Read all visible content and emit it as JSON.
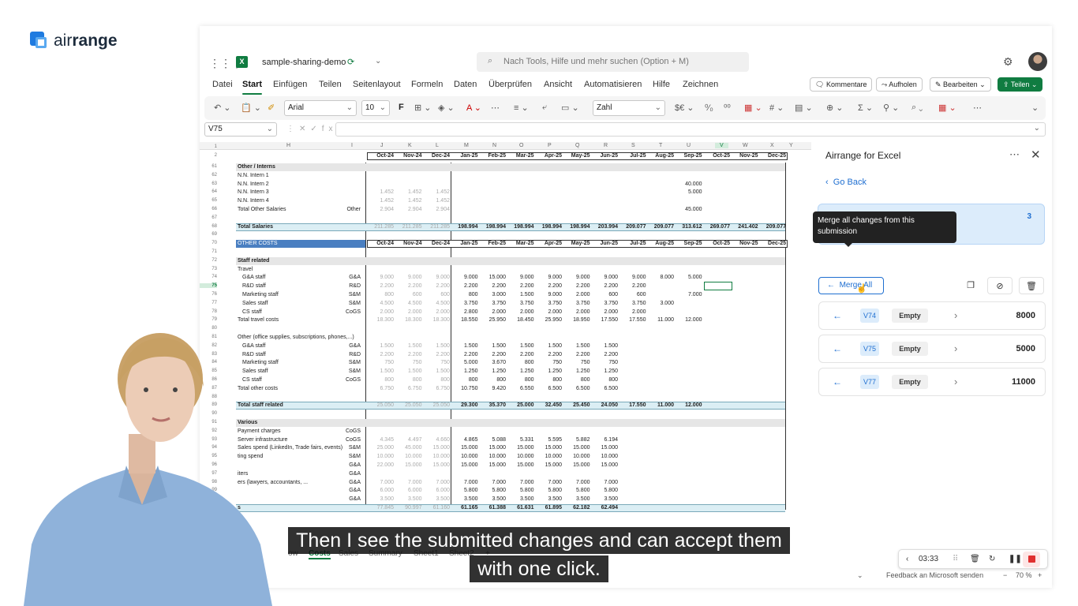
{
  "logo": {
    "prefix": "air",
    "suffix": "range"
  },
  "excel": {
    "file_name": "sample-sharing-demo",
    "search_placeholder": "Nach Tools, Hilfe und mehr suchen (Option + M)",
    "menu": [
      "Datei",
      "Start",
      "Einfügen",
      "Teilen",
      "Seitenlayout",
      "Formeln",
      "Daten",
      "Überprüfen",
      "Ansicht",
      "Automatisieren",
      "Hilfe",
      "Zeichnen"
    ],
    "actions": {
      "comments": "Kommentare",
      "catchup": "Aufholen",
      "editing": "Bearbeiten",
      "share": "Teilen"
    },
    "ribbon": {
      "font": "Arial",
      "size": "10",
      "format": "Zahl",
      "bold": "F"
    },
    "name_box": "V75",
    "col_headers": [
      "H",
      "I",
      "J",
      "K",
      "L",
      "M",
      "N",
      "O",
      "P",
      "Q",
      "R",
      "S",
      "T",
      "U",
      "V",
      "W",
      "X",
      "Y"
    ],
    "months": [
      "Oct-24",
      "Nov-24",
      "Dec-24",
      "Jan-25",
      "Feb-25",
      "Mar-25",
      "Apr-25",
      "May-25",
      "Jun-25",
      "Jul-25",
      "Aug-25",
      "Sep-25",
      "Oct-25",
      "Nov-25",
      "Dec-25"
    ],
    "rows": [
      {
        "n": "61",
        "label": "Other / Interns",
        "tag": "",
        "vals": [],
        "style": "section"
      },
      {
        "n": "62",
        "label": "N.N. Intern 1",
        "tag": "",
        "vals": []
      },
      {
        "n": "63",
        "label": "N.N. Intern 2",
        "tag": "",
        "vals": [
          "",
          "",
          "",
          "",
          "",
          "",
          "",
          "",
          "",
          "",
          "",
          "40.000"
        ]
      },
      {
        "n": "64",
        "label": "N.N. Intern 3",
        "tag": "",
        "vals": [
          "1.452",
          "1.452",
          "1.452",
          "",
          "",
          "",
          "",
          "",
          "",
          "",
          "",
          "5.000"
        ]
      },
      {
        "n": "65",
        "label": "N.N. Intern 4",
        "tag": "",
        "vals": [
          "1.452",
          "1.452",
          "1.452"
        ]
      },
      {
        "n": "66",
        "label": "Total Other Salaries",
        "tag": "Other",
        "vals": [
          "2.904",
          "2.904",
          "2.904",
          "",
          "",
          "",
          "",
          "",
          "",
          "",
          "",
          "45.000"
        ]
      },
      {
        "n": "67",
        "label": "",
        "tag": "",
        "vals": []
      },
      {
        "n": "68",
        "label": "Total Salaries",
        "tag": "",
        "vals": [
          "211.285",
          "211.285",
          "211.285",
          "198.994",
          "198.994",
          "198.994",
          "198.994",
          "198.994",
          "203.994",
          "209.077",
          "209.077",
          "313.612",
          "269.077",
          "241.402",
          "209.077"
        ],
        "style": "total"
      },
      {
        "n": "69",
        "label": "",
        "tag": "",
        "vals": []
      },
      {
        "n": "70",
        "label": "OTHER COSTS",
        "tag": "",
        "vals": [],
        "style": "header"
      },
      {
        "n": "71",
        "label": "",
        "tag": "",
        "vals": []
      },
      {
        "n": "72",
        "label": "Staff related",
        "tag": "",
        "vals": [],
        "style": "section"
      },
      {
        "n": "73",
        "label": "Travel",
        "tag": "",
        "vals": []
      },
      {
        "n": "74",
        "label": "G&A staff",
        "tag": "G&A",
        "vals": [
          "9.000",
          "9.000",
          "9.000",
          "9.000",
          "15.000",
          "9.000",
          "9.000",
          "9.000",
          "9.000",
          "9.000",
          "8.000",
          "5.000"
        ]
      },
      {
        "n": "75",
        "label": "R&D staff",
        "tag": "R&D",
        "vals": [
          "2.200",
          "2.200",
          "2.200",
          "2.200",
          "2.200",
          "2.200",
          "2.200",
          "2.200",
          "2.200",
          "2.200"
        ]
      },
      {
        "n": "76",
        "label": "Marketing staff",
        "tag": "S&M",
        "vals": [
          "800",
          "600",
          "600",
          "800",
          "3.000",
          "1.500",
          "9.000",
          "2.000",
          "600",
          "600",
          "",
          "7.000"
        ]
      },
      {
        "n": "77",
        "label": "Sales staff",
        "tag": "S&M",
        "vals": [
          "4.500",
          "4.500",
          "4.500",
          "3.750",
          "3.750",
          "3.750",
          "3.750",
          "3.750",
          "3.750",
          "3.750",
          "3.000"
        ]
      },
      {
        "n": "78",
        "label": "CS staff",
        "tag": "CoGS",
        "vals": [
          "2.000",
          "2.000",
          "2.000",
          "2.800",
          "2.000",
          "2.000",
          "2.000",
          "2.000",
          "2.000",
          "2.000"
        ]
      },
      {
        "n": "79",
        "label": "Total travel costs",
        "tag": "",
        "vals": [
          "18.300",
          "18.300",
          "18.300",
          "18.550",
          "25.950",
          "18.450",
          "25.950",
          "18.950",
          "17.550",
          "17.550",
          "11.000",
          "12.000"
        ]
      },
      {
        "n": "80",
        "label": "",
        "tag": "",
        "vals": []
      },
      {
        "n": "81",
        "label": "Other (office supplies, subscriptions, phones,...)",
        "tag": "",
        "vals": []
      },
      {
        "n": "82",
        "label": "G&A staff",
        "tag": "G&A",
        "vals": [
          "1.500",
          "1.500",
          "1.500",
          "1.500",
          "1.500",
          "1.500",
          "1.500",
          "1.500",
          "1.500"
        ]
      },
      {
        "n": "83",
        "label": "R&D staff",
        "tag": "R&D",
        "vals": [
          "2.200",
          "2.200",
          "2.200",
          "2.200",
          "2.200",
          "2.200",
          "2.200",
          "2.200",
          "2.200"
        ]
      },
      {
        "n": "84",
        "label": "Marketing staff",
        "tag": "S&M",
        "vals": [
          "750",
          "750",
          "750",
          "5.000",
          "3.670",
          "800",
          "750",
          "750",
          "750"
        ]
      },
      {
        "n": "85",
        "label": "Sales staff",
        "tag": "S&M",
        "vals": [
          "1.500",
          "1.500",
          "1.500",
          "1.250",
          "1.250",
          "1.250",
          "1.250",
          "1.250",
          "1.250"
        ]
      },
      {
        "n": "86",
        "label": "CS staff",
        "tag": "CoGS",
        "vals": [
          "800",
          "800",
          "800",
          "800",
          "800",
          "800",
          "800",
          "800",
          "800"
        ]
      },
      {
        "n": "87",
        "label": "Total other costs",
        "tag": "",
        "vals": [
          "6.750",
          "6.750",
          "6.750",
          "10.750",
          "9.420",
          "6.550",
          "6.500",
          "6.500",
          "6.500"
        ]
      },
      {
        "n": "88",
        "label": "",
        "tag": "",
        "vals": []
      },
      {
        "n": "89",
        "label": "Total staff related",
        "tag": "",
        "vals": [
          "25.050",
          "25.050",
          "25.050",
          "29.300",
          "35.370",
          "25.000",
          "32.450",
          "25.450",
          "24.050",
          "17.550",
          "11.000",
          "12.000"
        ],
        "style": "total"
      },
      {
        "n": "90",
        "label": "",
        "tag": "",
        "vals": []
      },
      {
        "n": "91",
        "label": "Various",
        "tag": "",
        "vals": [],
        "style": "section"
      },
      {
        "n": "92",
        "label": "Payment charges",
        "tag": "CoGS",
        "vals": []
      },
      {
        "n": "93",
        "label": "Server infrastructure",
        "tag": "CoGS",
        "vals": [
          "4.345",
          "4.497",
          "4.660",
          "4.865",
          "5.088",
          "5.331",
          "5.595",
          "5.882",
          "6.194"
        ]
      },
      {
        "n": "94",
        "label": "Sales spend (LinkedIn, Trade fairs, events)",
        "tag": "S&M",
        "vals": [
          "25.000",
          "45.000",
          "15.000",
          "15.000",
          "15.000",
          "15.000",
          "15.000",
          "15.000",
          "15.000"
        ]
      },
      {
        "n": "95",
        "label": "ting spend",
        "tag": "S&M",
        "vals": [
          "10.000",
          "10.000",
          "10.000",
          "10.000",
          "10.000",
          "10.000",
          "10.000",
          "10.000",
          "10.000"
        ]
      },
      {
        "n": "96",
        "label": "",
        "tag": "G&A",
        "vals": [
          "22.000",
          "15.000",
          "15.000",
          "15.000",
          "15.000",
          "15.000",
          "15.000",
          "15.000",
          "15.000"
        ]
      },
      {
        "n": "97",
        "label": "iters",
        "tag": "G&A",
        "vals": []
      },
      {
        "n": "98",
        "label": "ers (lawyers, accountants, ...",
        "tag": "G&A",
        "vals": [
          "7.000",
          "7.000",
          "7.000",
          "7.000",
          "7.000",
          "7.000",
          "7.000",
          "7.000",
          "7.000"
        ]
      },
      {
        "n": "99",
        "label": "",
        "tag": "G&A",
        "vals": [
          "6.000",
          "6.000",
          "6.000",
          "5.800",
          "5.800",
          "5.800",
          "5.800",
          "5.800",
          "5.800"
        ]
      },
      {
        "n": "100",
        "label": "",
        "tag": "G&A",
        "vals": [
          "3.500",
          "3.500",
          "3.500",
          "3.500",
          "3.500",
          "3.500",
          "3.500",
          "3.500",
          "3.500"
        ]
      },
      {
        "n": "101",
        "label": "s",
        "tag": "",
        "vals": [
          "77.845",
          "90.997",
          "61.160",
          "61.165",
          "61.388",
          "61.631",
          "61.895",
          "62.182",
          "62.494"
        ],
        "style": "total"
      }
    ],
    "sheet_tabs": [
      "ow",
      "Costs",
      "Sales",
      "Summary",
      "Sheet1",
      "Sheet2"
    ],
    "status": {
      "feedback": "Feedback an Microsoft senden",
      "zoom": "70 %"
    }
  },
  "panel": {
    "title": "Airrange for Excel",
    "go_back": "Go Back",
    "count": "3",
    "tooltip": "Merge all changes from this submission",
    "merge_all": "Merge All",
    "changes": [
      {
        "ref": "V74",
        "old": "Empty",
        "new": "8000"
      },
      {
        "ref": "V75",
        "old": "Empty",
        "new": "5000"
      },
      {
        "ref": "V77",
        "old": "Empty",
        "new": "11000"
      }
    ]
  },
  "caption": {
    "line1": "Then I see the submitted changes and can accept them",
    "line2": "with one click."
  },
  "recorder": {
    "time": "03:33"
  }
}
